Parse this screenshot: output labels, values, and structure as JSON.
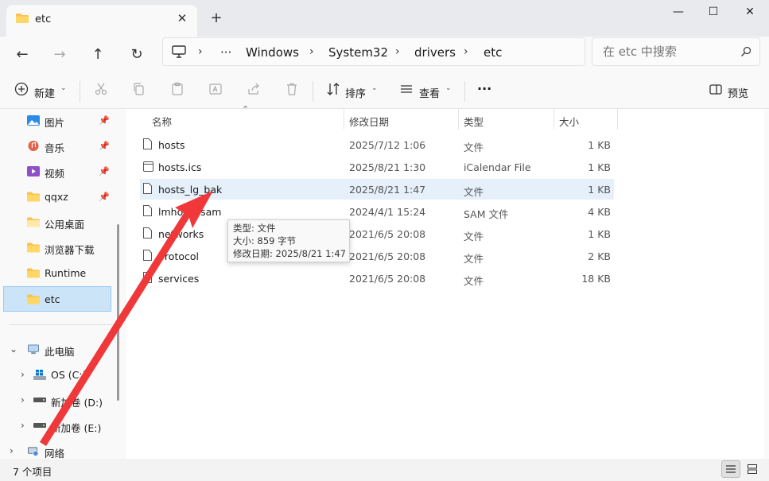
{
  "window": {
    "tab_title": "etc",
    "close_tab_glyph": "✕",
    "new_tab_glyph": "+",
    "minimize_glyph": "—",
    "maximize_glyph": "☐",
    "close_glyph": "✕"
  },
  "nav": {
    "back_glyph": "←",
    "forward_glyph": "→",
    "up_glyph": "↑",
    "refresh_glyph": "↻",
    "breadcrumb": [
      "Windows",
      "System32",
      "drivers",
      "etc"
    ],
    "overflow": "···",
    "separator": "›",
    "search_placeholder": "在 etc 中搜索"
  },
  "toolbar": {
    "new_label": "新建",
    "sort_label": "排序",
    "view_label": "查看",
    "more_glyph": "···",
    "preview_label": "预览"
  },
  "sidebar": {
    "pinned": [
      {
        "label": "图片",
        "icon": "pictures-icon"
      },
      {
        "label": "音乐",
        "icon": "music-icon"
      },
      {
        "label": "视频",
        "icon": "videos-icon"
      },
      {
        "label": "qqxz",
        "icon": "folder-icon"
      },
      {
        "label": "公用桌面",
        "icon": "folder-icon"
      },
      {
        "label": "浏览器下载",
        "icon": "folder-icon"
      },
      {
        "label": "Runtime",
        "icon": "folder-icon"
      },
      {
        "label": "etc",
        "icon": "folder-icon"
      }
    ],
    "this_pc": "此电脑",
    "drives": [
      "OS (C:)",
      "新加卷 (D:)",
      "新加卷 (E:)"
    ],
    "network": "网络",
    "pin_glyph": "📌",
    "expand_glyph": "›",
    "collapse_glyph": "⌄"
  },
  "columns": {
    "name": "名称",
    "modified": "修改日期",
    "type": "类型",
    "size": "大小"
  },
  "files": [
    {
      "name": "hosts",
      "modified": "2025/7/12 1:06",
      "type": "文件",
      "size": "1 KB"
    },
    {
      "name": "hosts.ics",
      "modified": "2025/8/21 1:30",
      "type": "iCalendar File",
      "size": "1 KB"
    },
    {
      "name": "hosts_lg_bak",
      "modified": "2025/8/21 1:47",
      "type": "文件",
      "size": "1 KB"
    },
    {
      "name": "lmhosts.sam",
      "modified": "2024/4/1 15:24",
      "type": "SAM 文件",
      "size": "4 KB"
    },
    {
      "name": "networks",
      "modified": "2021/6/5 20:08",
      "type": "文件",
      "size": "1 KB"
    },
    {
      "name": "protocol",
      "modified": "2021/6/5 20:08",
      "type": "文件",
      "size": "2 KB"
    },
    {
      "name": "services",
      "modified": "2021/6/5 20:08",
      "type": "文件",
      "size": "18 KB"
    }
  ],
  "tooltip": {
    "type_line": "类型: 文件",
    "size_line": "大小: 859 字节",
    "date_line": "修改日期: 2025/8/21 1:47"
  },
  "status": {
    "item_count": "7 个项目"
  },
  "colors": {
    "accent": "#0067c0",
    "selection": "#cce4f7",
    "hover_row": "#e5f0fb",
    "arrow": "#f0373a",
    "folder": "#f8c44f"
  }
}
